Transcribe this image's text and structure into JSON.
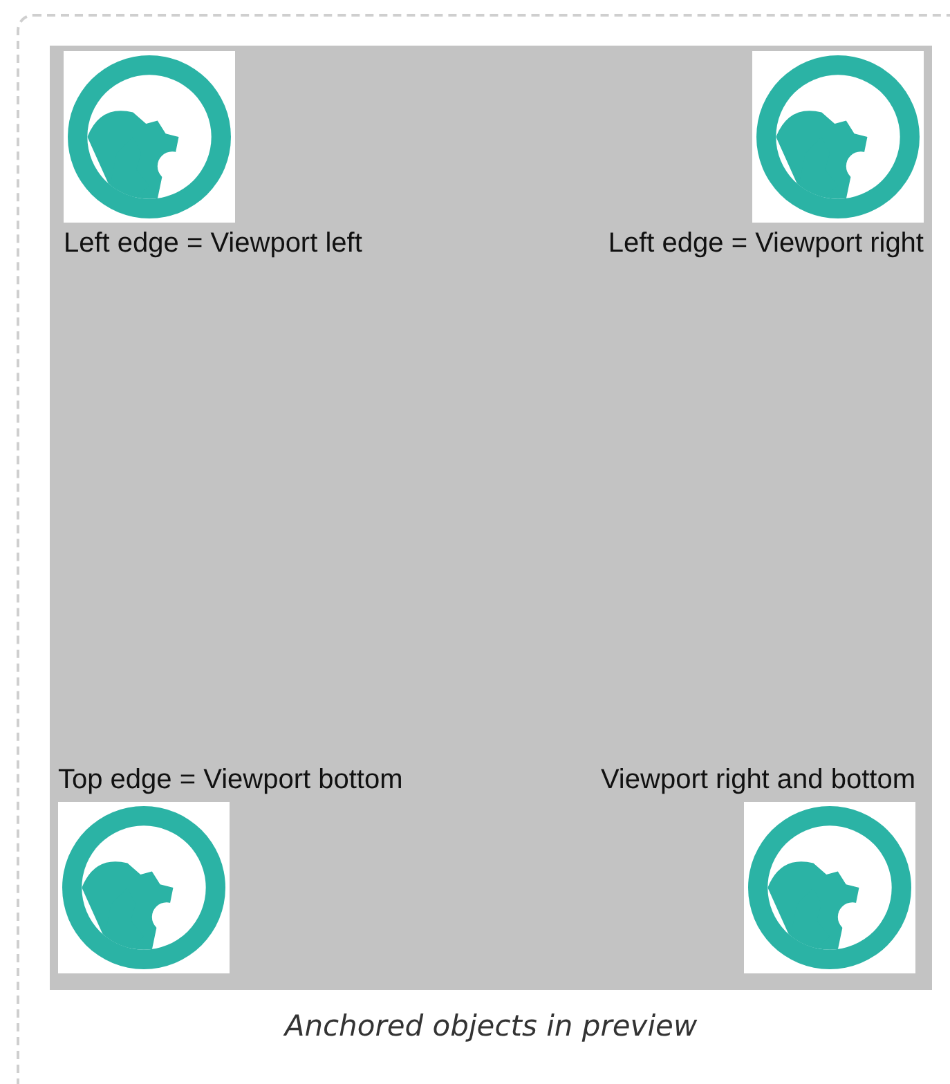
{
  "preview": {
    "items": [
      {
        "kind": "topleft",
        "label": "Left edge = Viewport left"
      },
      {
        "kind": "topright",
        "label": "Left edge = Viewport right"
      },
      {
        "kind": "bottomleft",
        "label": "Top edge = Viewport bottom"
      },
      {
        "kind": "bottomright",
        "label": "Viewport right and bottom"
      }
    ]
  },
  "caption": "Anchored objects in preview"
}
